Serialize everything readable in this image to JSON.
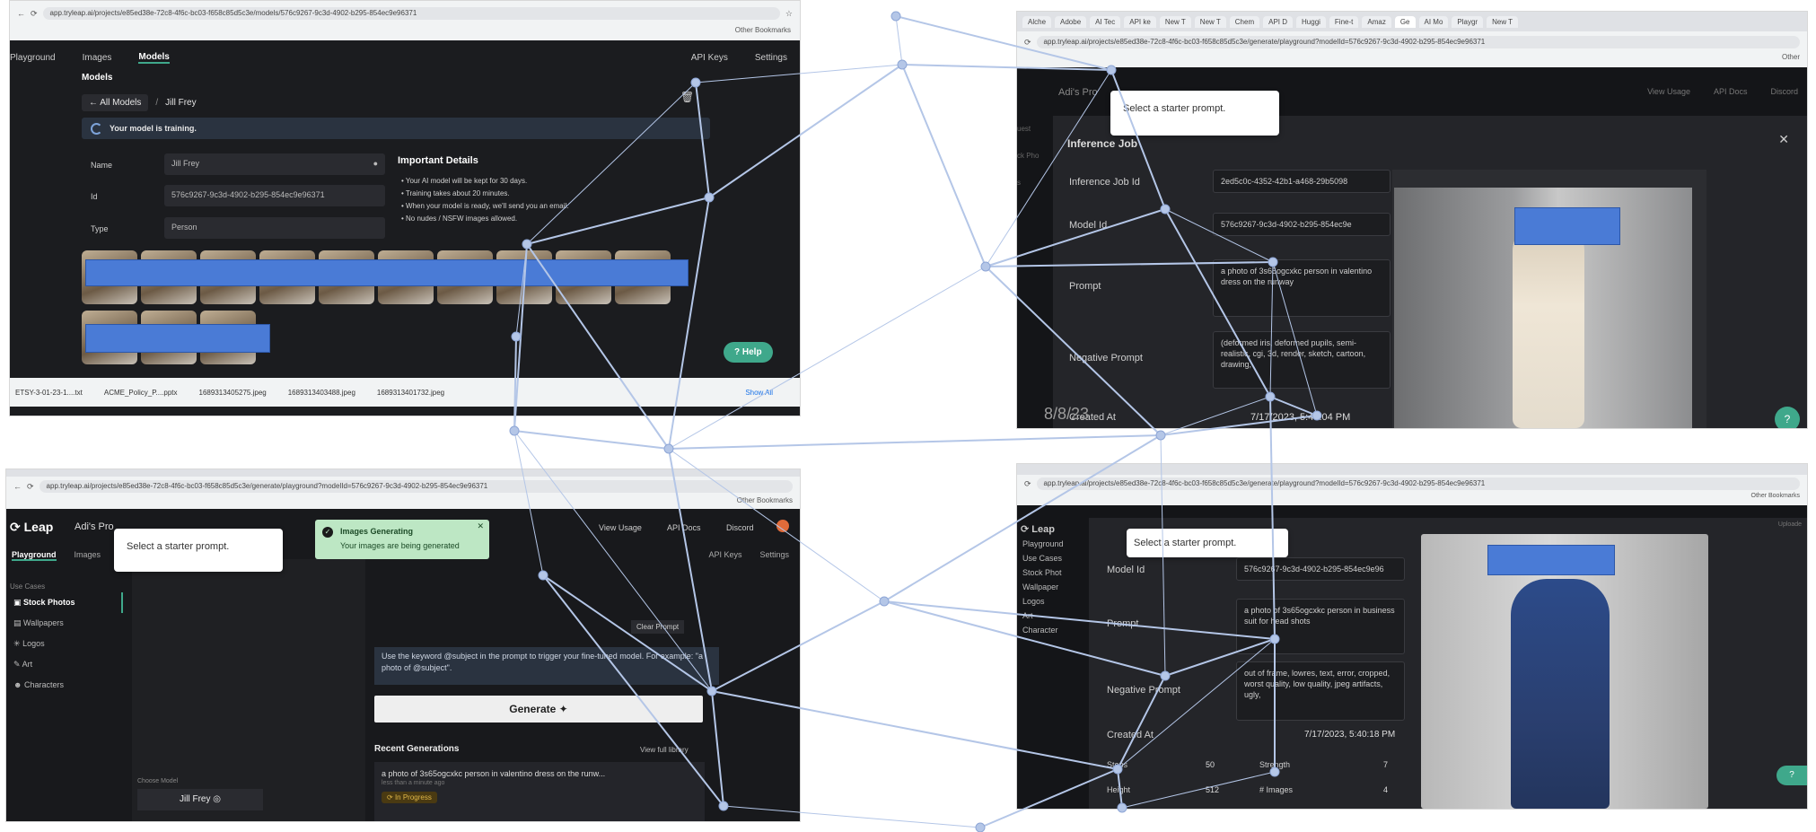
{
  "panel_tl": {
    "address": "app.tryleap.ai/projects/e85ed38e-72c8-4f6c-bc03-f658c85d5c3e/models/576c9267-9c3d-4902-b295-854ec9e96371",
    "bookmarks": "Other Bookmarks",
    "nav": [
      "Playground",
      "Images",
      "Models"
    ],
    "nav_right": [
      "API Keys",
      "Settings"
    ],
    "section_title": "Models",
    "breadcrumb_back": "← All Models",
    "breadcrumb_sep": "/",
    "breadcrumb_current": "Jill Frey",
    "training_status": "Your model is training.",
    "fields": [
      {
        "label": "Name",
        "value": "Jill Frey"
      },
      {
        "label": "Id",
        "value": "576c9267-9c3d-4902-b295-854ec9e96371"
      },
      {
        "label": "Type",
        "value": "Person"
      }
    ],
    "details_title": "Important Details",
    "details": [
      "• Your AI model will be kept for 30 days.",
      "• Training takes about 20 minutes.",
      "• When your model is ready, we'll send you an email.",
      "• No nudes / NSFW images allowed."
    ],
    "help_label": "Help",
    "downloads": [
      "ETSY-3-01-23-1....txt",
      "ACME_Policy_P....pptx",
      "1689313405275.jpeg",
      "1689313403488.jpeg",
      "1689313401732.jpeg"
    ],
    "show_all": "Show All"
  },
  "panel_tr": {
    "tabs": [
      "Alche",
      "Adobe",
      "AI Tec",
      "API ke",
      "New T",
      "New T",
      "Chem",
      "API D",
      "Huggi",
      "Fine-t",
      "Amaz",
      "Ge",
      "AI Mo",
      "Playgr",
      "New T"
    ],
    "address": "app.tryleap.ai/projects/e85ed38e-72c8-4f6c-bc03-f658c85d5c3e/generate/playground?modelId=576c9267-9c3d-4902-b295-854ec9e96371",
    "bookmarks": "Other",
    "project": "Adi's Pro",
    "header_links": [
      "View Usage",
      "API Docs",
      "Discord"
    ],
    "popover": "Select a starter prompt.",
    "modal_title": "Inference Job",
    "rows": [
      {
        "label": "Inference Job Id",
        "value": "2ed5c0c-4352-42b1-a468-29b5098"
      },
      {
        "label": "Model Id",
        "value": "576c9267-9c3d-4902-b295-854ec9e"
      },
      {
        "label": "Prompt",
        "value": "a photo of 3s65ogcxkc person in valentino dress on the runway"
      },
      {
        "label": "Negative Prompt",
        "value": "(deformed iris, deformed pupils, semi-realistic, cgi, 3d, render, sketch, cartoon, drawing,"
      },
      {
        "label": "Created At",
        "value": "7/17/2023, 5:45:04 PM"
      }
    ],
    "watermark_date": "8/8/23",
    "sidebar_frag": [
      "uest",
      "ck Pho",
      "s"
    ]
  },
  "panel_bl": {
    "address": "app.tryleap.ai/projects/e85ed38e-72c8-4f6c-bc03-f658c85d5c3e/generate/playground?modelId=576c9267-9c3d-4902-b295-854ec9e96371",
    "bookmarks": "Other Bookmarks",
    "logo": "Leap",
    "project": "Adi's Pro",
    "popover": "Select a starter prompt.",
    "toast_title": "Images Generating",
    "toast_body": "Your images are being generated",
    "header_links": [
      "View Usage",
      "API Docs",
      "Discord"
    ],
    "nav": [
      "Playground",
      "Images"
    ],
    "nav_right": [
      "API Keys",
      "Settings"
    ],
    "use_cases_label": "Use Cases",
    "use_cases": [
      "Stock Photos",
      "Wallpapers",
      "Logos",
      "Art",
      "Characters"
    ],
    "clear_prompt": "Clear Prompt",
    "hint": "Use the keyword @subject in the prompt to trigger your fine-tuned model. For example: \"a photo of @subject\".",
    "generate_label": "Generate",
    "recent_title": "Recent Generations",
    "view_library": "View full library",
    "recent_prompt": "a photo of 3s65ogcxkc person in valentino dress on the runw...",
    "recent_sub": "less than a minute ago",
    "in_progress": "In Progress",
    "choose_model_label": "Choose Model",
    "model_name": "Jill Frey"
  },
  "panel_br": {
    "address": "app.tryleap.ai/projects/e85ed38e-72c8-4f6c-bc03-f658c85d5c3e/generate/playground?modelId=576c9267-9c3d-4902-b295-854ec9e96371",
    "bookmarks": "Other Bookmarks",
    "logo": "Leap",
    "sidebar": [
      "Playground",
      "Use Cases",
      "Stock Phot",
      "Wallpaper",
      "Logos",
      "Art",
      "Character"
    ],
    "popover": "Select a starter prompt.",
    "rows": [
      {
        "label": "Model Id",
        "value": "576c9267-9c3d-4902-b295-854ec9e96"
      },
      {
        "label": "Prompt",
        "value": "a photo of 3s65ogcxkc person in business suit for head shots"
      },
      {
        "label": "Negative Prompt",
        "value": "out of frame, lowres, text, error, cropped, worst quality, low quality, jpeg artifacts, ugly,"
      }
    ],
    "created_label": "Created At",
    "created_value": "7/17/2023, 5:40:18 PM",
    "steps_label": "Steps",
    "steps_value": "50",
    "strength_label": "Strength",
    "strength_value": "7",
    "height_label": "Height",
    "height_value": "512",
    "images_label": "# Images",
    "images_value": "4",
    "right_frag": "Uploade"
  },
  "colors": {
    "redact": "#4a7bd6",
    "network": "#b4c6e7",
    "accent_green": "#3fa88b",
    "toast": "#bde7c4"
  }
}
